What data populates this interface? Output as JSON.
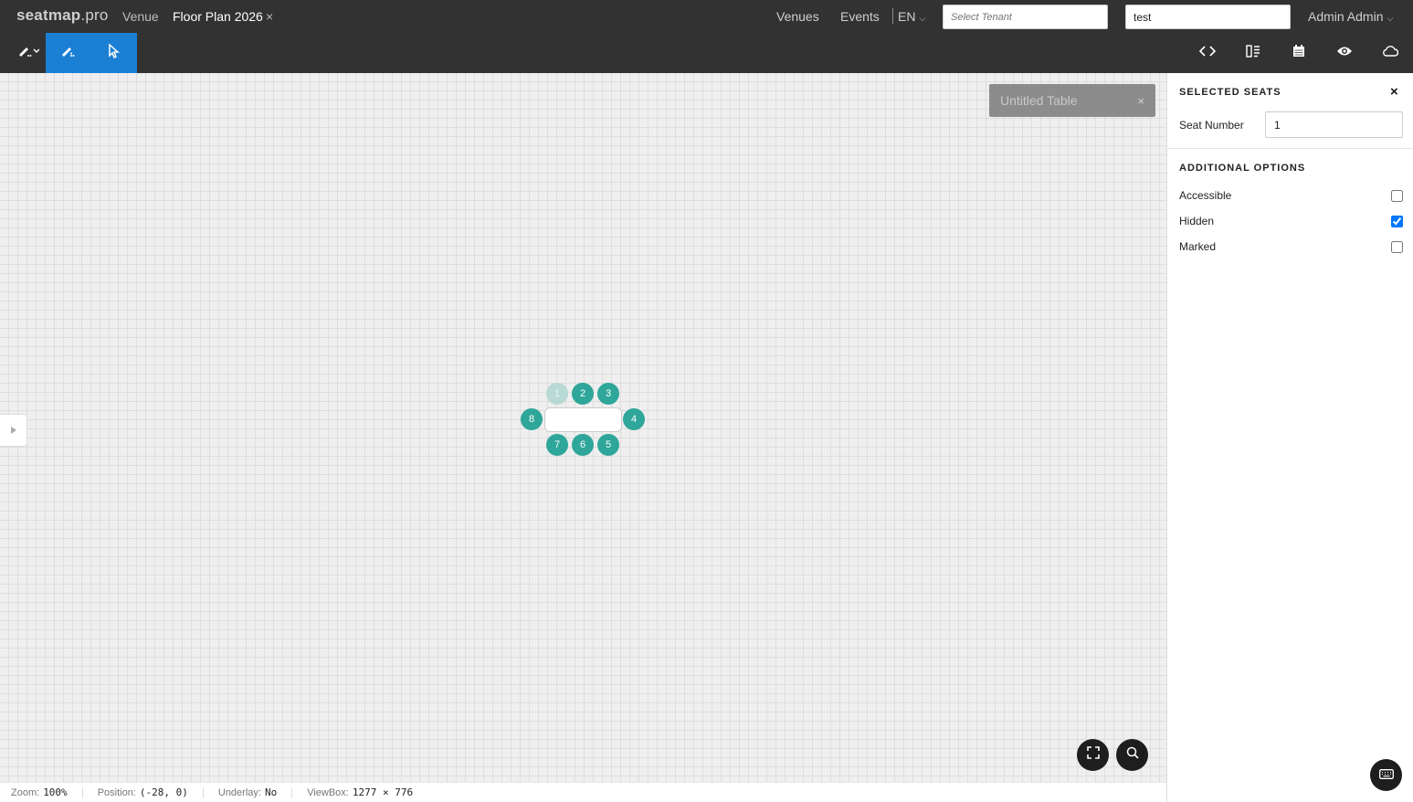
{
  "header": {
    "brand_bold": "seatmap",
    "brand_light": ".pro",
    "breadcrumb_venue": "Venue",
    "breadcrumb_plan": "Floor Plan 2026",
    "close_glyph": "×",
    "nav_venues": "Venues",
    "nav_events": "Events",
    "language": "EN",
    "tenant_placeholder": "Select Tenant",
    "search_value": "test",
    "user": "Admin Admin"
  },
  "toolbar": {
    "left_tools": [
      "pen-options-icon",
      "pen-tool-icon",
      "cursor-select-icon"
    ],
    "right_tools": [
      "code-icon",
      "list-layout-icon",
      "calendar-icon",
      "eye-icon",
      "cloud-icon"
    ]
  },
  "canvas": {
    "table_name": "Untitled Table",
    "seats": [
      {
        "label": "1",
        "hidden": true
      },
      {
        "label": "2",
        "hidden": false
      },
      {
        "label": "3",
        "hidden": false
      },
      {
        "label": "4",
        "hidden": false
      },
      {
        "label": "5",
        "hidden": false
      },
      {
        "label": "6",
        "hidden": false
      },
      {
        "label": "7",
        "hidden": false
      },
      {
        "label": "8",
        "hidden": false
      }
    ],
    "seat_color": "#2fa69a",
    "hidden_seat_color": "#b9d9d5"
  },
  "status": {
    "zoom_label": "Zoom:",
    "zoom_value": "100%",
    "position_label": "Position:",
    "position_value": "(-28, 0)",
    "underlay_label": "Underlay:",
    "underlay_value": "No",
    "viewbox_label": "ViewBox:",
    "viewbox_value": "1277 × 776"
  },
  "panel": {
    "title": "SELECTED SEATS",
    "seat_number_label": "Seat Number",
    "seat_number_value": "1",
    "options_title": "ADDITIONAL OPTIONS",
    "options": [
      {
        "label": "Accessible",
        "checked": false
      },
      {
        "label": "Hidden",
        "checked": true
      },
      {
        "label": "Marked",
        "checked": false
      }
    ]
  },
  "accent_color": "#1b7fd4"
}
